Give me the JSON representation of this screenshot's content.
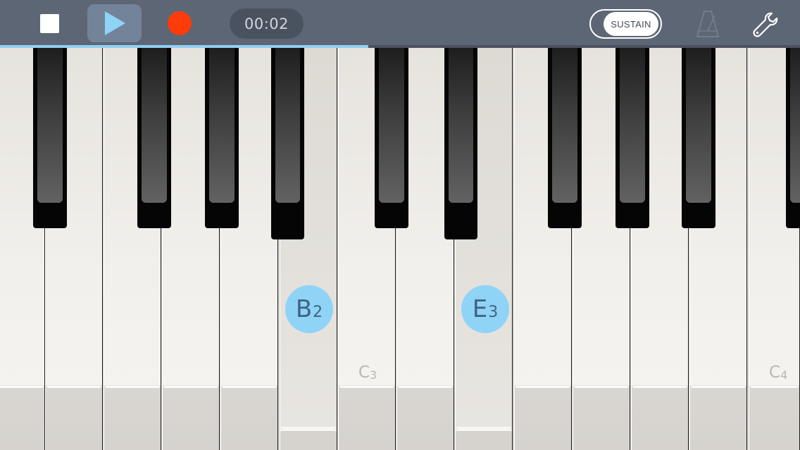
{
  "toolbar": {
    "timer": "00:02",
    "sustain_label": "SUSTAIN",
    "icons": {
      "stop": "stop-icon",
      "play": "play-icon",
      "record": "record-icon",
      "metronome": "metronome-icon",
      "settings": "wrench-icon"
    }
  },
  "progress": {
    "fraction": 0.46
  },
  "keyboard": {
    "labels": [
      {
        "note": "C",
        "octave": "3"
      },
      {
        "note": "C",
        "octave": "4"
      }
    ],
    "active_notes": [
      {
        "note": "B",
        "octave": "2"
      },
      {
        "note": "E",
        "octave": "3"
      }
    ]
  },
  "colors": {
    "toolbar_bg": "#5d6675",
    "accent": "#8fd3f7",
    "record": "#ff3b0a"
  }
}
